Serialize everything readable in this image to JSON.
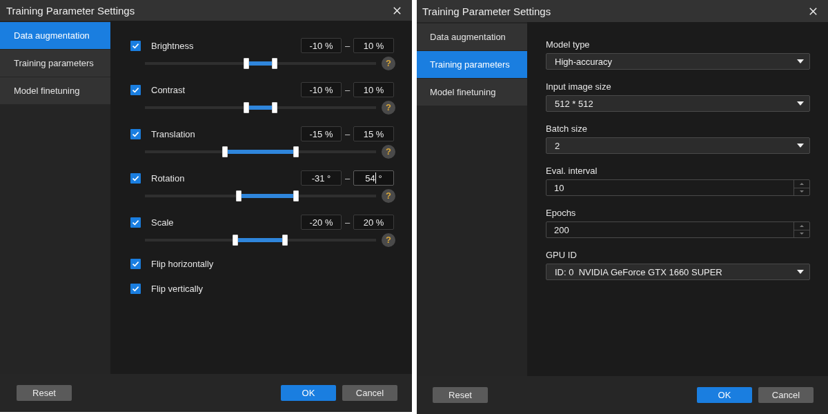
{
  "dialogs": [
    {
      "title": "Training Parameter Settings",
      "tabs": [
        {
          "label": "Data augmentation",
          "selected": true
        },
        {
          "label": "Training parameters",
          "selected": false
        },
        {
          "label": "Model finetuning",
          "selected": false
        }
      ],
      "settings": [
        {
          "kind": "range",
          "label": "Brightness",
          "checked": true,
          "min": {
            "value": "-10",
            "suffix": " %",
            "focused": false
          },
          "separator": "–",
          "max": {
            "value": "10",
            "suffix": " %",
            "focused": false
          },
          "thumbs": [
            {
              "level": 0.44
            },
            {
              "level": 0.56
            }
          ],
          "help": "?"
        },
        {
          "kind": "range",
          "label": "Contrast",
          "checked": true,
          "min": {
            "value": "-10",
            "suffix": " %",
            "focused": false
          },
          "separator": "–",
          "max": {
            "value": "10",
            "suffix": " %",
            "focused": false
          },
          "thumbs": [
            {
              "level": 0.44
            },
            {
              "level": 0.56
            }
          ],
          "help": "?"
        },
        {
          "kind": "range",
          "label": "Translation",
          "checked": true,
          "min": {
            "value": "-15",
            "suffix": " %",
            "focused": false
          },
          "separator": "–",
          "max": {
            "value": "15",
            "suffix": " %",
            "focused": false
          },
          "thumbs": [
            {
              "level": 0.345
            },
            {
              "level": 0.655
            }
          ],
          "help": "?"
        },
        {
          "kind": "range",
          "label": "Rotation",
          "checked": true,
          "min": {
            "value": "-31",
            "suffix": " °",
            "focused": false
          },
          "separator": "–",
          "max": {
            "value": "54",
            "suffix": " °",
            "focused": true
          },
          "thumbs": [
            {
              "level": 0.407
            },
            {
              "level": 0.655
            }
          ],
          "help": "?"
        },
        {
          "kind": "range",
          "label": "Scale",
          "checked": true,
          "min": {
            "value": "-20",
            "suffix": " %",
            "focused": false
          },
          "separator": "–",
          "max": {
            "value": "20",
            "suffix": " %",
            "focused": false
          },
          "thumbs": [
            {
              "level": 0.39
            },
            {
              "level": 0.607
            }
          ],
          "help": "?"
        },
        {
          "kind": "toggle",
          "label": "Flip horizontally",
          "checked": true
        },
        {
          "kind": "toggle",
          "label": "Flip vertically",
          "checked": true
        }
      ],
      "buttons": [
        {
          "label": "Reset",
          "kind": "default"
        },
        {
          "label": "OK",
          "kind": "primary"
        },
        {
          "label": "Cancel",
          "kind": "default"
        }
      ]
    },
    {
      "title": "Training Parameter Settings",
      "tabs": [
        {
          "label": "Data augmentation",
          "selected": false
        },
        {
          "label": "Training parameters",
          "selected": true
        },
        {
          "label": "Model finetuning",
          "selected": false
        }
      ],
      "settings": [
        {
          "kind": "dropdown",
          "label": "Model type",
          "value": "High-accuracy"
        },
        {
          "kind": "dropdown",
          "label": "Input image size",
          "value": "512 * 512"
        },
        {
          "kind": "dropdown",
          "label": "Batch size",
          "value": "2"
        },
        {
          "kind": "spinbox",
          "label": "Eval. interval",
          "value": "10"
        },
        {
          "kind": "spinbox",
          "label": "Epochs",
          "value": "200"
        },
        {
          "kind": "dropdown",
          "label": "GPU ID",
          "value": "ID: 0  NVIDIA GeForce GTX 1660 SUPER"
        }
      ],
      "buttons": [
        {
          "label": "Reset",
          "kind": "default"
        },
        {
          "label": "OK",
          "kind": "primary"
        },
        {
          "label": "Cancel",
          "kind": "default"
        }
      ]
    }
  ]
}
